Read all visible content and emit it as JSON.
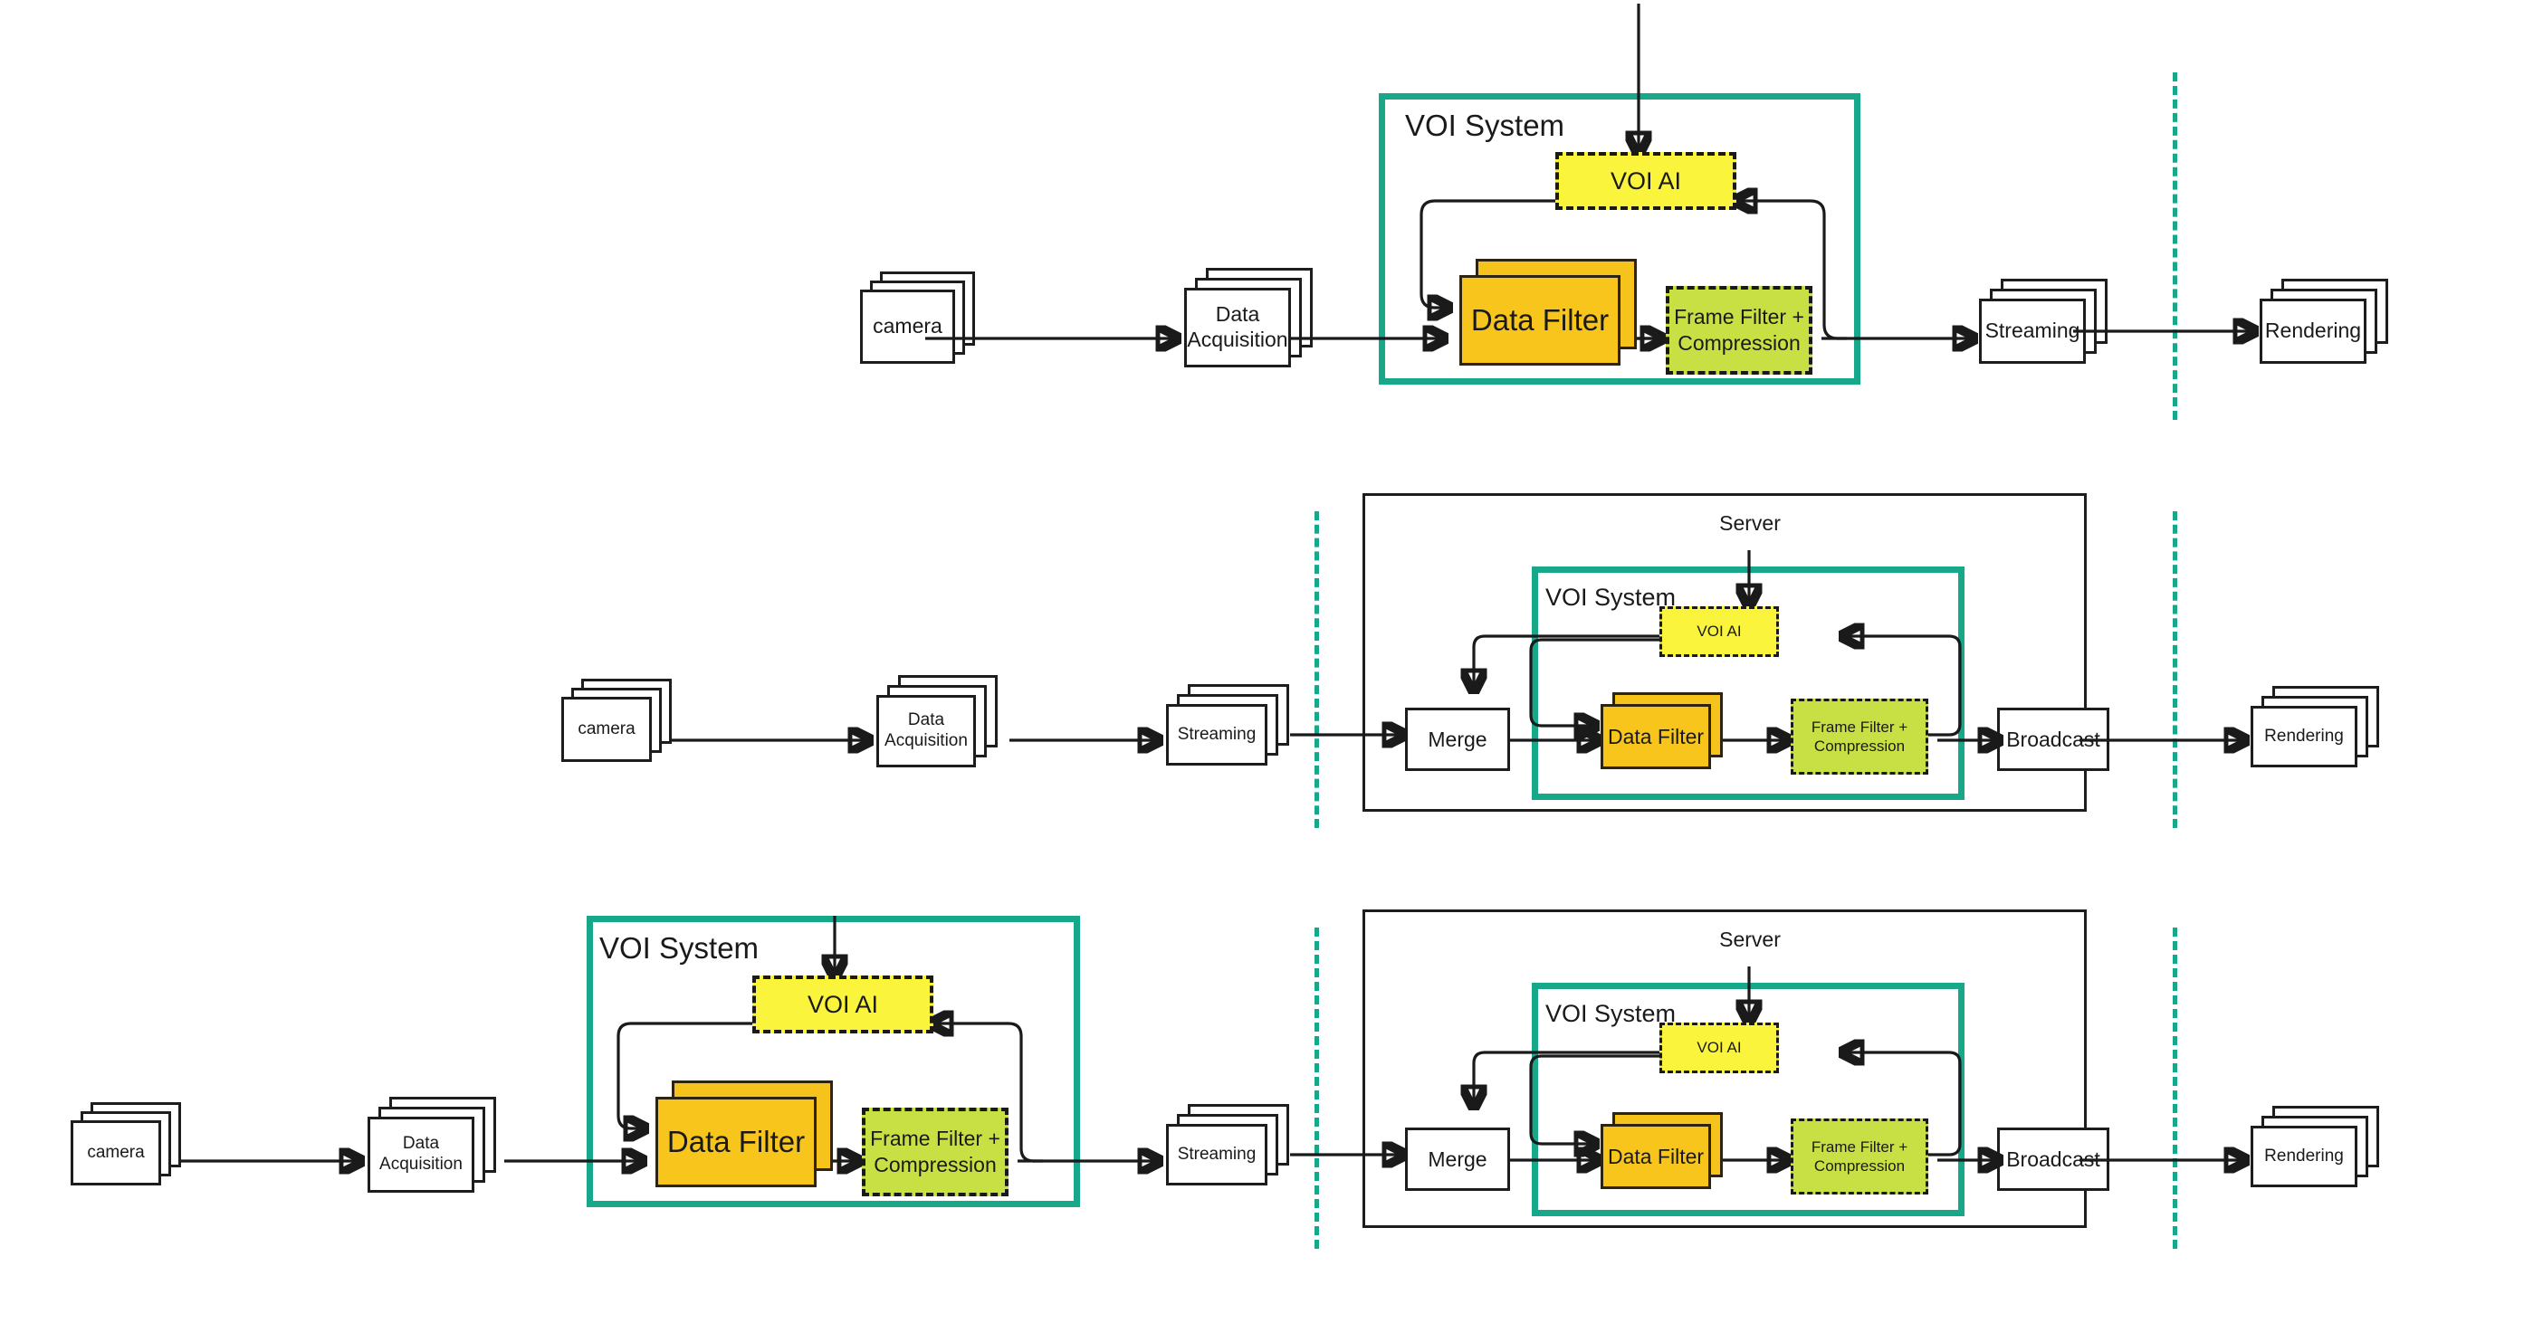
{
  "diagram": {
    "title": "VOI System pipeline architecture — three deployment variants",
    "colors": {
      "voi_container_border": "#17a88a",
      "divider": "#17a88a",
      "voi_ai_fill": "#fbf43c",
      "data_filter_fill": "#f8c51d",
      "frame_filter_fill": "#c9e045",
      "box_stroke": "#1d1d1d",
      "background": "#ffffff"
    },
    "labels": {
      "camera": "camera",
      "data_acquisition": "Data\nAcquisition",
      "data_acquisition_line1": "Data",
      "data_acquisition_line2": "Acquisition",
      "streaming": "Streaming",
      "rendering": "Rendering",
      "merge": "Merge",
      "broadcast": "Broadcast",
      "voi_system": "VOI System",
      "voi_ai": "VOI AI",
      "data_filter": "Data Filter",
      "frame_filter_line1": "Frame Filter +",
      "frame_filter_line2": "Compression",
      "server": "Server"
    }
  },
  "rows": [
    {
      "id": "row-1",
      "name": "edge-side-voi-system",
      "nodes": {
        "camera": "camera",
        "data_acquisition_l1": "Data",
        "data_acquisition_l2": "Acquisition",
        "voi_system": "VOI System",
        "voi_ai": "VOI AI",
        "data_filter": "Data Filter",
        "frame_filter_l1": "Frame Filter +",
        "frame_filter_l2": "Compression",
        "streaming": "Streaming",
        "rendering": "Rendering"
      }
    },
    {
      "id": "row-2",
      "name": "server-side-voi-system",
      "nodes": {
        "camera": "camera",
        "data_acquisition_l1": "Data",
        "data_acquisition_l2": "Acquisition",
        "streaming": "Streaming",
        "server": "Server",
        "merge": "Merge",
        "voi_system": "VOI System",
        "voi_ai": "VOI AI",
        "data_filter": "Data Filter",
        "frame_filter_l1": "Frame Filter +",
        "frame_filter_l2": "Compression",
        "broadcast": "Broadcast",
        "rendering": "Rendering"
      }
    },
    {
      "id": "row-3",
      "name": "edge-and-server-voi-system",
      "nodes": {
        "camera": "camera",
        "data_acquisition_l1": "Data",
        "data_acquisition_l2": "Acquisition",
        "voi_system_edge": "VOI System",
        "voi_ai_edge": "VOI AI",
        "data_filter_edge": "Data Filter",
        "frame_filter_edge_l1": "Frame Filter +",
        "frame_filter_edge_l2": "Compression",
        "streaming": "Streaming",
        "server": "Server",
        "merge": "Merge",
        "voi_system_server": "VOI System",
        "voi_ai_server": "VOI AI",
        "data_filter_server": "Data Filter",
        "frame_filter_server_l1": "Frame Filter +",
        "frame_filter_server_l2": "Compression",
        "broadcast": "Broadcast",
        "rendering": "Rendering"
      }
    }
  ]
}
